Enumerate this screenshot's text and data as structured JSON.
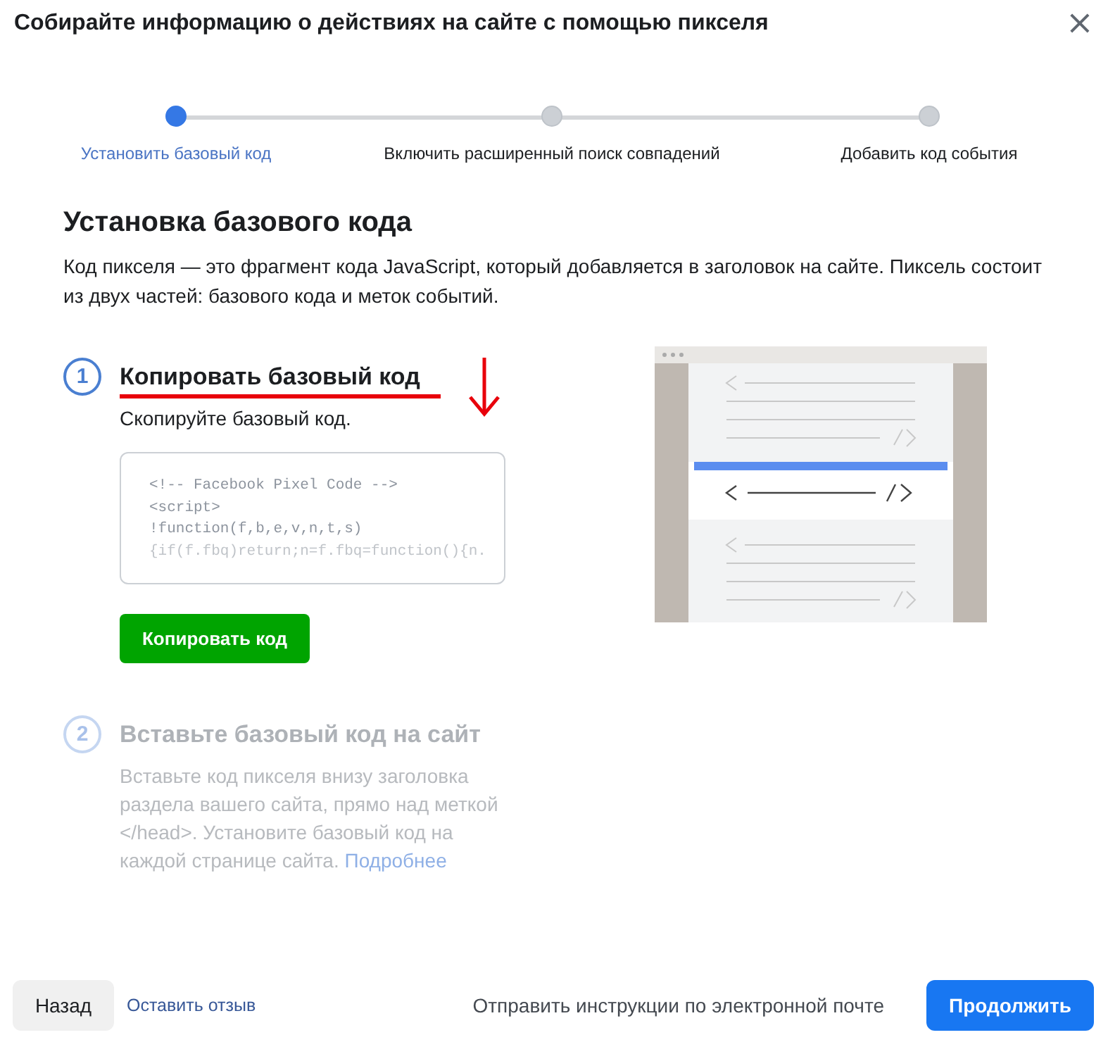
{
  "dialog": {
    "title": "Собирайте информацию о действиях на сайте с помощью пикселя",
    "close": "×"
  },
  "progress_steps": [
    {
      "label": "Установить базовый код",
      "selected": true
    },
    {
      "label": "Включить расширенный поиск совпадений",
      "selected": false
    },
    {
      "label": "Добавить код события",
      "selected": false
    }
  ],
  "section": {
    "heading": "Установка базового кода",
    "description": "Код пикселя — это фрагмент кода JavaScript, который добавляется в заголовок на сайте. Пиксель состоит из двух частей: базового кода и меток событий."
  },
  "instructions": [
    {
      "number": "1",
      "title": "Копировать базовый код",
      "disabled": false,
      "text": "Скопируйте базовый код.",
      "code_lines": [
        "<!-- Facebook Pixel Code -->",
        "<script>",
        "!function(f,b,e,v,n,t,s)",
        "{if(f.fbq)return;n=f.fbq=function(){n."
      ],
      "button": "Копировать код"
    },
    {
      "number": "2",
      "title": "Вставьте базовый код на сайт",
      "disabled": true,
      "text": "Вставьте код пикселя внизу заголовка раздела вашего сайта, прямо над меткой </head>. Установите базовый код на каждой странице сайта.",
      "link": "Подробнее"
    }
  ],
  "footer": {
    "back": "Назад",
    "feedback": "Оставить отзыв",
    "email": "Отправить инструкции по электронной почте",
    "continue": "Продолжить"
  }
}
